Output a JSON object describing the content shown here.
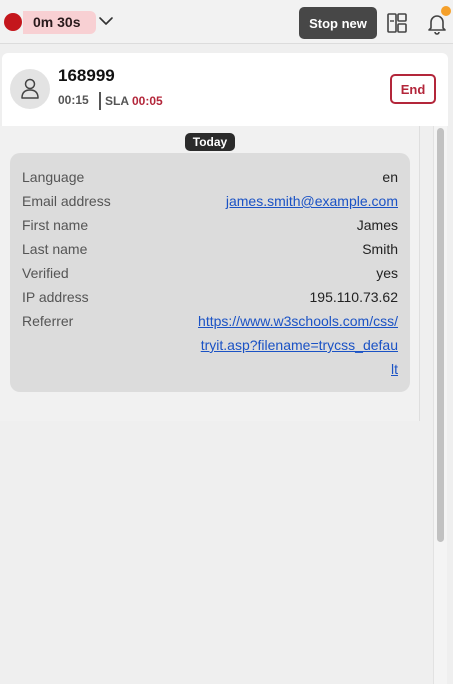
{
  "topbar": {
    "timer": "0m 30s",
    "stop_new_label": "Stop new",
    "icons": [
      "recording-dot",
      "chevron-down-icon",
      "layout-icon",
      "bell-icon"
    ],
    "colors": {
      "recording": "#c4161c",
      "notification": "#f5a02a"
    }
  },
  "conversation": {
    "id": "168999",
    "elapsed": "00:15",
    "sla_label": "SLA",
    "sla_value": "00:05",
    "end_label": "End"
  },
  "date_separator": "Today",
  "info": {
    "rows": [
      {
        "key": "Language",
        "value": "en"
      },
      {
        "key": "Email address",
        "value": "james.smith@example.com"
      },
      {
        "key": "First name",
        "value": "James"
      },
      {
        "key": "Last name",
        "value": "Smith"
      },
      {
        "key": "Verified",
        "value": "yes"
      },
      {
        "key": "IP address",
        "value": "195.110.73.62"
      },
      {
        "key": "Referrer",
        "value": "https://www.w3schools.com/css/tryit.asp?filename=trycss_default"
      }
    ]
  }
}
